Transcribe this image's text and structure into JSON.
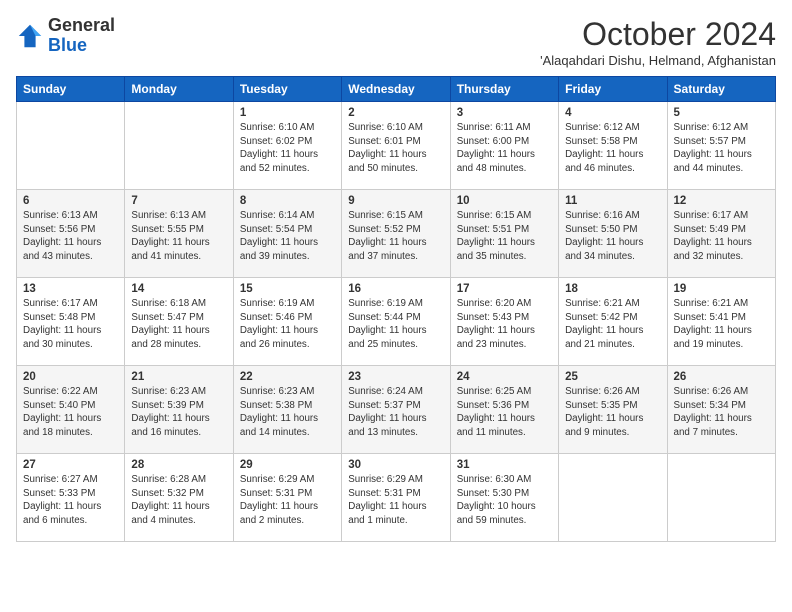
{
  "logo": {
    "general": "General",
    "blue": "Blue"
  },
  "title": "October 2024",
  "subtitle": "'Alaqahdari Dishu, Helmand, Afghanistan",
  "weekdays": [
    "Sunday",
    "Monday",
    "Tuesday",
    "Wednesday",
    "Thursday",
    "Friday",
    "Saturday"
  ],
  "weeks": [
    [
      {
        "day": "",
        "info": ""
      },
      {
        "day": "",
        "info": ""
      },
      {
        "day": "1",
        "info": "Sunrise: 6:10 AM\nSunset: 6:02 PM\nDaylight: 11 hours and 52 minutes."
      },
      {
        "day": "2",
        "info": "Sunrise: 6:10 AM\nSunset: 6:01 PM\nDaylight: 11 hours and 50 minutes."
      },
      {
        "day": "3",
        "info": "Sunrise: 6:11 AM\nSunset: 6:00 PM\nDaylight: 11 hours and 48 minutes."
      },
      {
        "day": "4",
        "info": "Sunrise: 6:12 AM\nSunset: 5:58 PM\nDaylight: 11 hours and 46 minutes."
      },
      {
        "day": "5",
        "info": "Sunrise: 6:12 AM\nSunset: 5:57 PM\nDaylight: 11 hours and 44 minutes."
      }
    ],
    [
      {
        "day": "6",
        "info": "Sunrise: 6:13 AM\nSunset: 5:56 PM\nDaylight: 11 hours and 43 minutes."
      },
      {
        "day": "7",
        "info": "Sunrise: 6:13 AM\nSunset: 5:55 PM\nDaylight: 11 hours and 41 minutes."
      },
      {
        "day": "8",
        "info": "Sunrise: 6:14 AM\nSunset: 5:54 PM\nDaylight: 11 hours and 39 minutes."
      },
      {
        "day": "9",
        "info": "Sunrise: 6:15 AM\nSunset: 5:52 PM\nDaylight: 11 hours and 37 minutes."
      },
      {
        "day": "10",
        "info": "Sunrise: 6:15 AM\nSunset: 5:51 PM\nDaylight: 11 hours and 35 minutes."
      },
      {
        "day": "11",
        "info": "Sunrise: 6:16 AM\nSunset: 5:50 PM\nDaylight: 11 hours and 34 minutes."
      },
      {
        "day": "12",
        "info": "Sunrise: 6:17 AM\nSunset: 5:49 PM\nDaylight: 11 hours and 32 minutes."
      }
    ],
    [
      {
        "day": "13",
        "info": "Sunrise: 6:17 AM\nSunset: 5:48 PM\nDaylight: 11 hours and 30 minutes."
      },
      {
        "day": "14",
        "info": "Sunrise: 6:18 AM\nSunset: 5:47 PM\nDaylight: 11 hours and 28 minutes."
      },
      {
        "day": "15",
        "info": "Sunrise: 6:19 AM\nSunset: 5:46 PM\nDaylight: 11 hours and 26 minutes."
      },
      {
        "day": "16",
        "info": "Sunrise: 6:19 AM\nSunset: 5:44 PM\nDaylight: 11 hours and 25 minutes."
      },
      {
        "day": "17",
        "info": "Sunrise: 6:20 AM\nSunset: 5:43 PM\nDaylight: 11 hours and 23 minutes."
      },
      {
        "day": "18",
        "info": "Sunrise: 6:21 AM\nSunset: 5:42 PM\nDaylight: 11 hours and 21 minutes."
      },
      {
        "day": "19",
        "info": "Sunrise: 6:21 AM\nSunset: 5:41 PM\nDaylight: 11 hours and 19 minutes."
      }
    ],
    [
      {
        "day": "20",
        "info": "Sunrise: 6:22 AM\nSunset: 5:40 PM\nDaylight: 11 hours and 18 minutes."
      },
      {
        "day": "21",
        "info": "Sunrise: 6:23 AM\nSunset: 5:39 PM\nDaylight: 11 hours and 16 minutes."
      },
      {
        "day": "22",
        "info": "Sunrise: 6:23 AM\nSunset: 5:38 PM\nDaylight: 11 hours and 14 minutes."
      },
      {
        "day": "23",
        "info": "Sunrise: 6:24 AM\nSunset: 5:37 PM\nDaylight: 11 hours and 13 minutes."
      },
      {
        "day": "24",
        "info": "Sunrise: 6:25 AM\nSunset: 5:36 PM\nDaylight: 11 hours and 11 minutes."
      },
      {
        "day": "25",
        "info": "Sunrise: 6:26 AM\nSunset: 5:35 PM\nDaylight: 11 hours and 9 minutes."
      },
      {
        "day": "26",
        "info": "Sunrise: 6:26 AM\nSunset: 5:34 PM\nDaylight: 11 hours and 7 minutes."
      }
    ],
    [
      {
        "day": "27",
        "info": "Sunrise: 6:27 AM\nSunset: 5:33 PM\nDaylight: 11 hours and 6 minutes."
      },
      {
        "day": "28",
        "info": "Sunrise: 6:28 AM\nSunset: 5:32 PM\nDaylight: 11 hours and 4 minutes."
      },
      {
        "day": "29",
        "info": "Sunrise: 6:29 AM\nSunset: 5:31 PM\nDaylight: 11 hours and 2 minutes."
      },
      {
        "day": "30",
        "info": "Sunrise: 6:29 AM\nSunset: 5:31 PM\nDaylight: 11 hours and 1 minute."
      },
      {
        "day": "31",
        "info": "Sunrise: 6:30 AM\nSunset: 5:30 PM\nDaylight: 10 hours and 59 minutes."
      },
      {
        "day": "",
        "info": ""
      },
      {
        "day": "",
        "info": ""
      }
    ]
  ]
}
